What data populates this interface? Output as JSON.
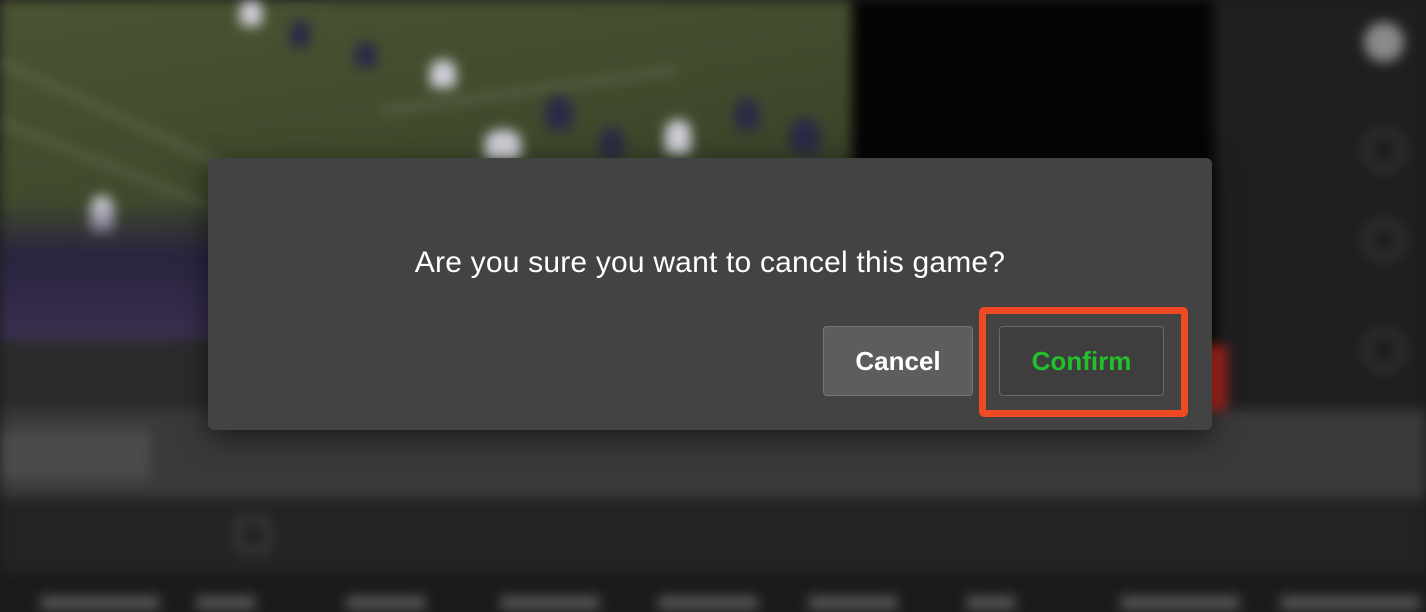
{
  "dialog": {
    "message": "Are you sure you want to cancel this game?",
    "cancel_label": "Cancel",
    "confirm_label": "Confirm"
  },
  "colors": {
    "dialog_bg": "#434343",
    "confirm_text": "#22c12a",
    "highlight_outline": "#f04a24"
  },
  "background_icons": [
    "circle-icon"
  ]
}
